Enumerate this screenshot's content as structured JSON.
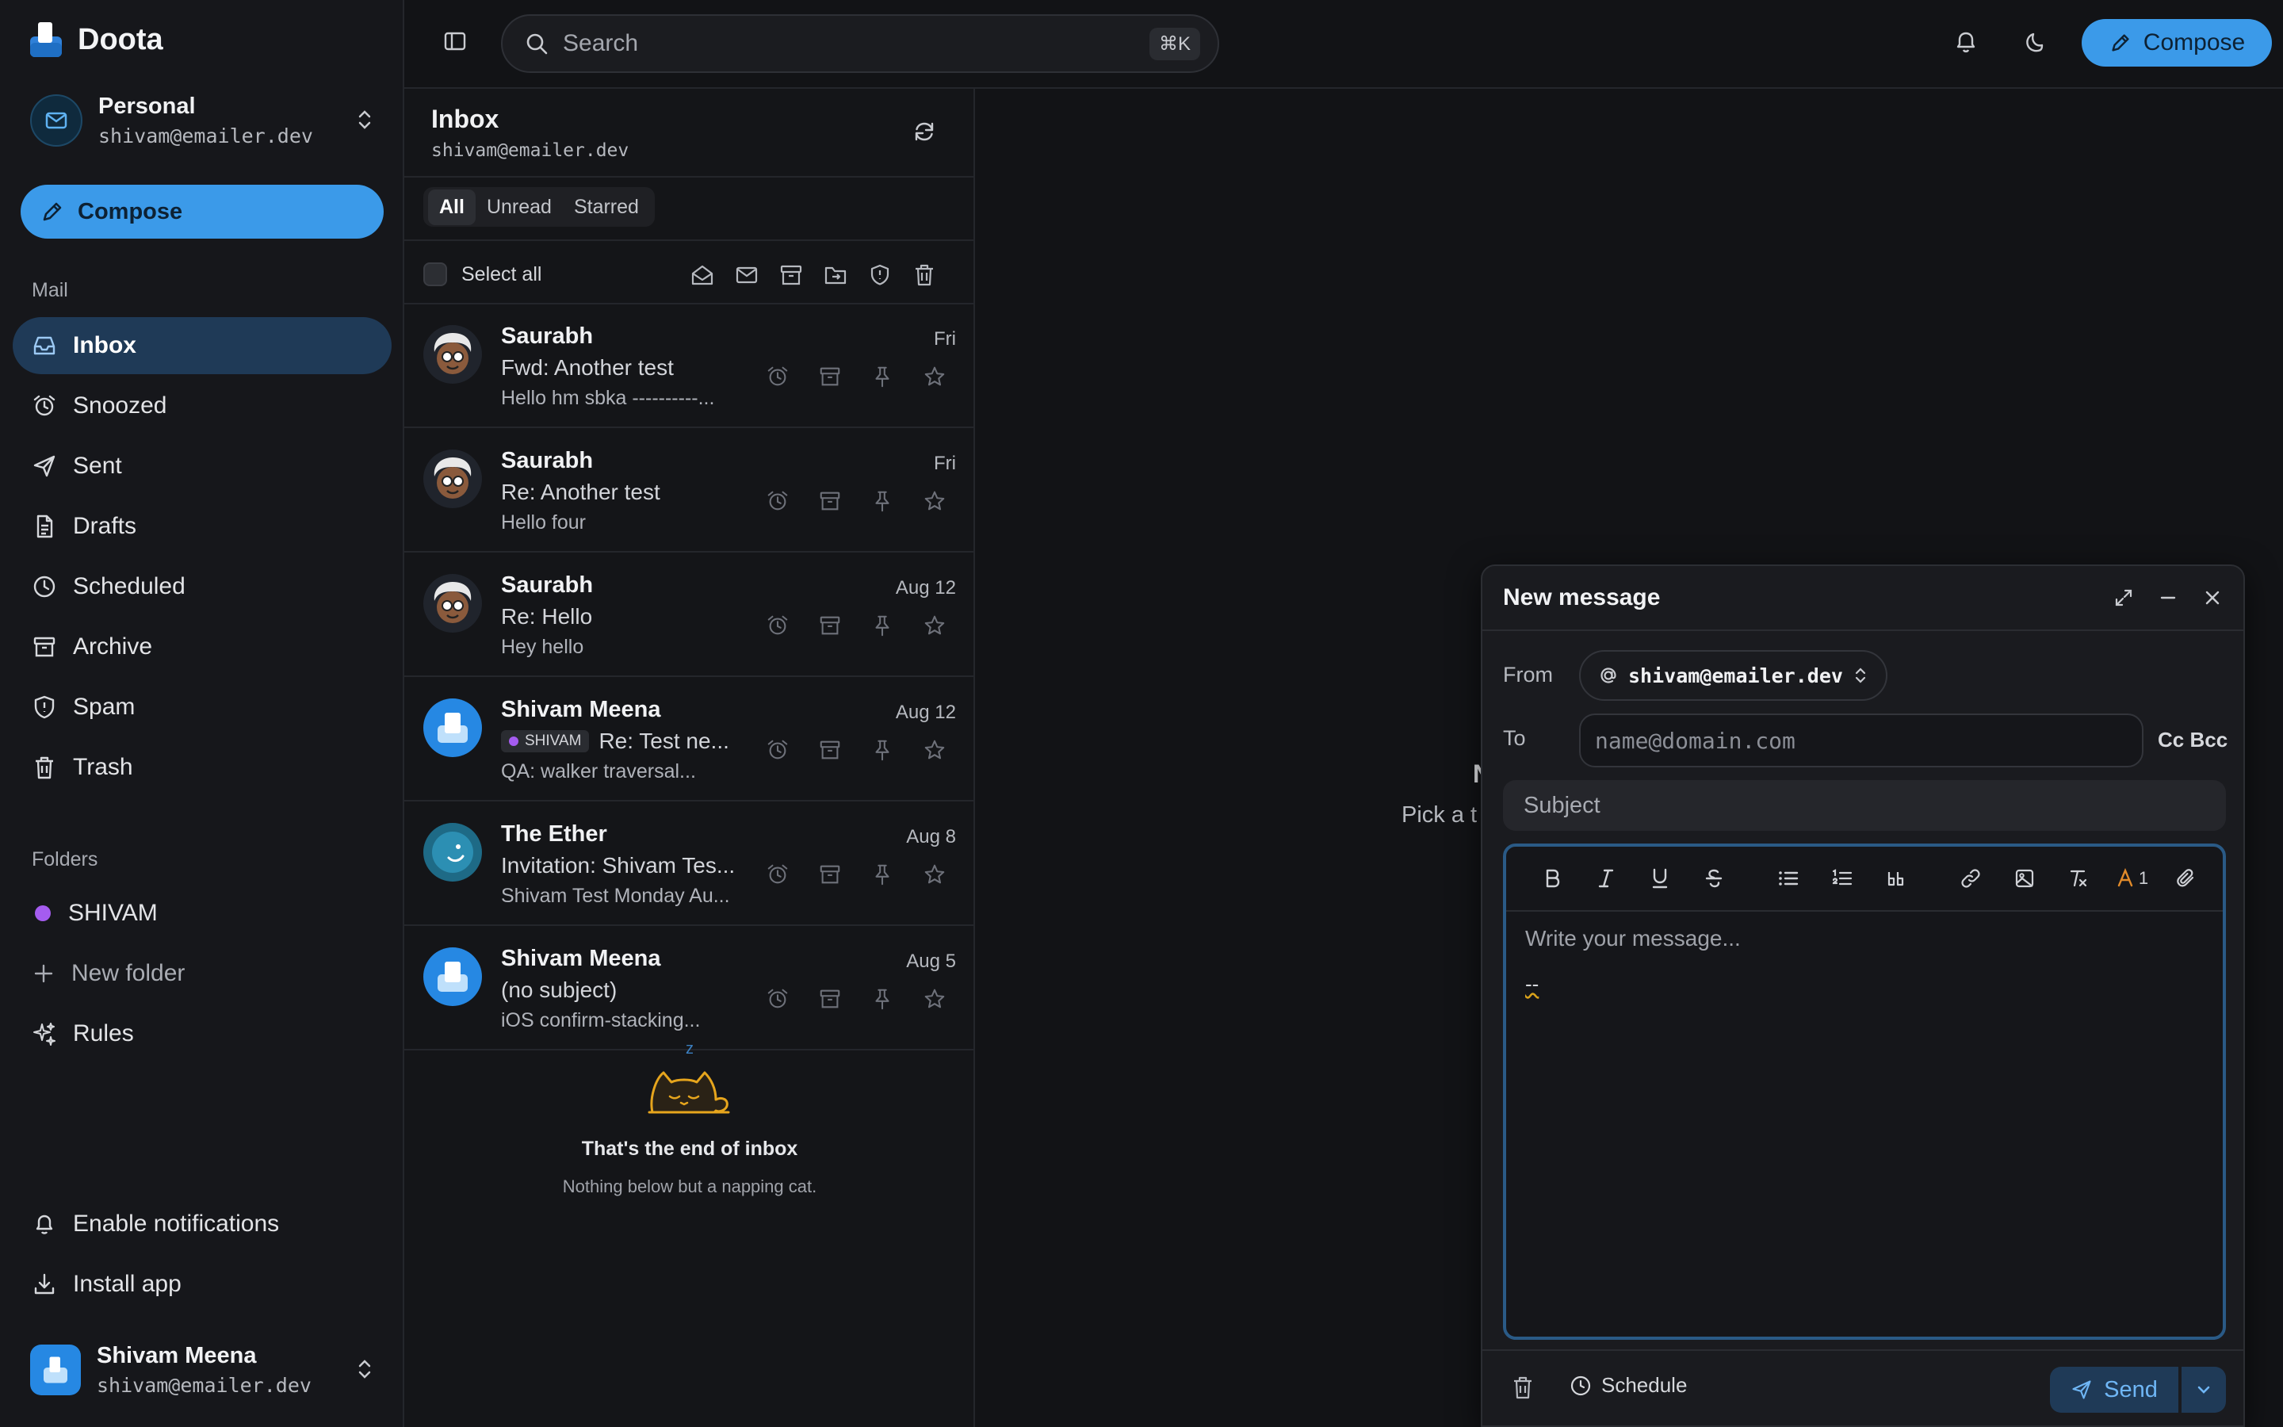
{
  "app": {
    "name": "Doota"
  },
  "account": {
    "name": "Personal",
    "email": "shivam@emailer.dev"
  },
  "sidebar": {
    "compose_label": "Compose",
    "mail_section": "Mail",
    "items": [
      {
        "label": "Inbox",
        "icon": "inbox-icon"
      },
      {
        "label": "Snoozed",
        "icon": "alarm-clock-icon"
      },
      {
        "label": "Sent",
        "icon": "send-icon"
      },
      {
        "label": "Drafts",
        "icon": "file-text-icon"
      },
      {
        "label": "Scheduled",
        "icon": "clock-icon"
      },
      {
        "label": "Archive",
        "icon": "archive-icon"
      },
      {
        "label": "Spam",
        "icon": "shield-alert-icon"
      },
      {
        "label": "Trash",
        "icon": "trash-icon"
      }
    ],
    "folders_section": "Folders",
    "folders": [
      {
        "label": "SHIVAM",
        "color": "#a55cf0"
      }
    ],
    "new_folder": "New folder",
    "rules": "Rules",
    "enable_notifications": "Enable notifications",
    "install_app": "Install app",
    "user": {
      "name": "Shivam Meena",
      "email": "shivam@emailer.dev"
    }
  },
  "topbar": {
    "search_placeholder": "Search",
    "search_shortcut": "⌘K",
    "compose_label": "Compose"
  },
  "inbox": {
    "title": "Inbox",
    "email": "shivam@emailer.dev",
    "tabs": [
      "All",
      "Unread",
      "Starred"
    ],
    "select_all": "Select all",
    "messages": [
      {
        "sender": "Saurabh",
        "date": "Fri",
        "subject": "Fwd: Another test",
        "preview": "Hello hm sbka ----------...",
        "avatar": "cartoon"
      },
      {
        "sender": "Saurabh",
        "date": "Fri",
        "subject": "Re: Another test",
        "preview": "Hello four",
        "avatar": "cartoon"
      },
      {
        "sender": "Saurabh",
        "date": "Aug 12",
        "subject": "Re: Hello",
        "preview": "Hey hello",
        "avatar": "cartoon"
      },
      {
        "sender": "Shivam Meena",
        "date": "Aug 12",
        "tag": "SHIVAM",
        "subject": "Re: Test ne...",
        "preview": "QA: walker traversal...",
        "avatar": "logo"
      },
      {
        "sender": "The Ether",
        "date": "Aug 8",
        "subject": "Invitation: Shivam Tes...",
        "preview": "Shivam Test Monday Au...",
        "avatar": "ether"
      },
      {
        "sender": "Shivam Meena",
        "date": "Aug 5",
        "subject": "(no subject)",
        "preview": "iOS confirm-stacking...",
        "avatar": "logo"
      }
    ],
    "end_z": "z",
    "end_title": "That's the end of inbox",
    "end_subtitle": "Nothing below but a napping cat."
  },
  "reader": {
    "empty_title_visible": "N",
    "empty_subtitle_visible": "Pick a t"
  },
  "composer": {
    "title": "New message",
    "from_label": "From",
    "from_value": "shivam@emailer.dev",
    "to_label": "To",
    "to_placeholder": "name@domain.com",
    "cc_bcc": "Cc Bcc",
    "subject_placeholder": "Subject",
    "body_placeholder": "Write your message...",
    "signature": "--",
    "color_badge": "1",
    "schedule_label": "Schedule",
    "send_label": "Send"
  },
  "colors": {
    "accent": "#3b9ae9",
    "active_nav": "#1f3a57",
    "folder": "#a55cf0",
    "background": "#121316"
  }
}
